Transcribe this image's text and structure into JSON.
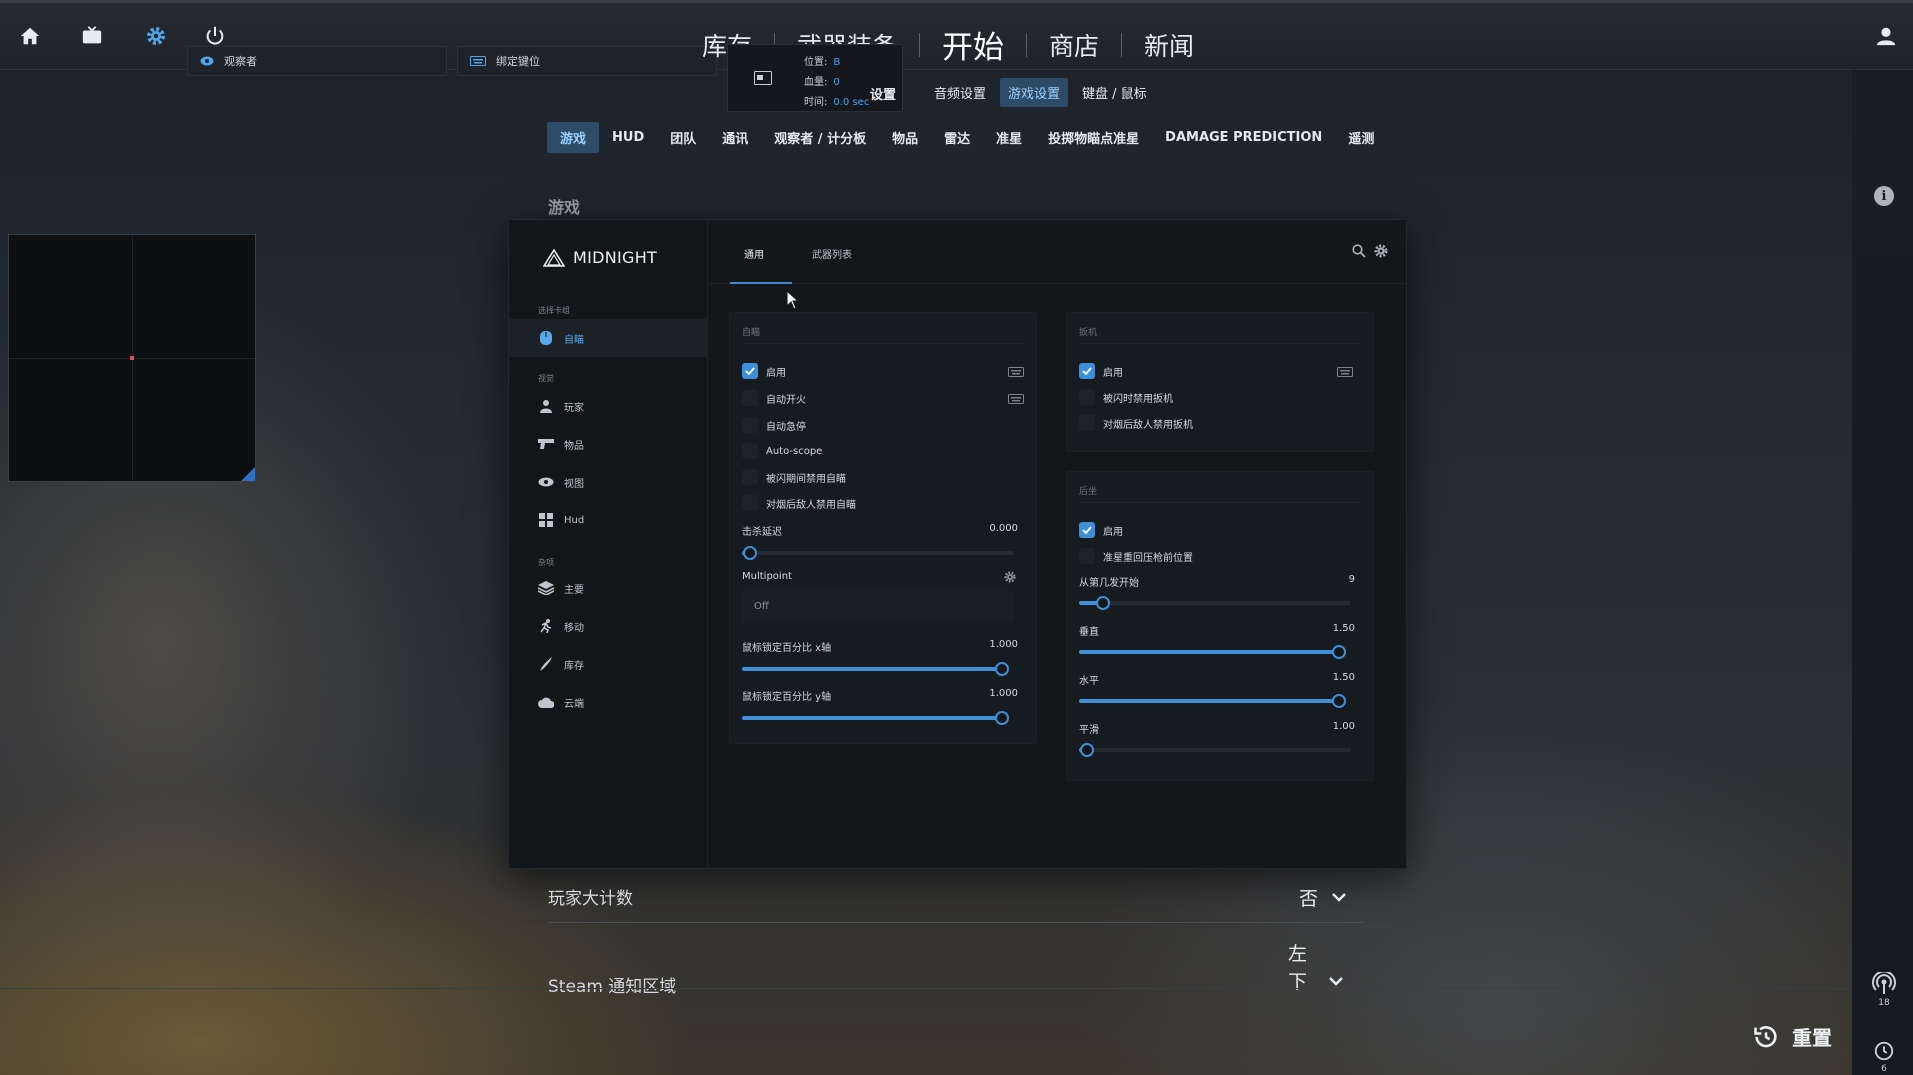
{
  "topnav": {
    "items": [
      {
        "label": "库存",
        "active": false
      },
      {
        "label": "武器装备",
        "active": false
      },
      {
        "label": "开始",
        "active": true
      },
      {
        "label": "商店",
        "active": false
      },
      {
        "label": "新闻",
        "active": false
      }
    ],
    "chips": [
      {
        "label": "观察者",
        "icon": "eye-icon"
      },
      {
        "label": "绑定键位",
        "icon": "keyboard-icon"
      }
    ]
  },
  "overlay": {
    "rows": [
      {
        "label": "位置:",
        "value": "B"
      },
      {
        "label": "血量:",
        "value": "0"
      },
      {
        "label": "时间:",
        "value": "0.0 sec"
      }
    ],
    "partial_tab": "设置"
  },
  "settings_tabs": [
    {
      "label": "音频设置",
      "active": false
    },
    {
      "label": "游戏设置",
      "active": true
    },
    {
      "label": "键盘 / 鼠标",
      "active": false
    }
  ],
  "sub_tabs": [
    {
      "label": "游戏",
      "active": true
    },
    {
      "label": "HUD",
      "active": false
    },
    {
      "label": "团队",
      "active": false
    },
    {
      "label": "通讯",
      "active": false
    },
    {
      "label": "观察者 / 计分板",
      "active": false
    },
    {
      "label": "物品",
      "active": false
    },
    {
      "label": "雷达",
      "active": false
    },
    {
      "label": "准星",
      "active": false
    },
    {
      "label": "投掷物瞄点准星",
      "active": false
    },
    {
      "label": "DAMAGE PREDICTION",
      "active": false
    },
    {
      "label": "遥测",
      "active": false
    }
  ],
  "section_title": "游戏",
  "panel": {
    "brand": "MIDNIGHT",
    "groups": [
      {
        "label": "选择卡组"
      },
      {
        "label": "视觉"
      },
      {
        "label": "杂项"
      }
    ],
    "side_items": [
      {
        "label": "自瞄",
        "icon": "aim-icon",
        "active": true
      },
      {
        "label": "玩家",
        "icon": "user-icon",
        "active": false
      },
      {
        "label": "物品",
        "icon": "gun-icon",
        "active": false
      },
      {
        "label": "视图",
        "icon": "eye-icon",
        "active": false
      },
      {
        "label": "Hud",
        "icon": "grid-icon",
        "active": false
      },
      {
        "label": "主要",
        "icon": "layers-icon",
        "active": false
      },
      {
        "label": "移动",
        "icon": "run-icon",
        "active": false
      },
      {
        "label": "库存",
        "icon": "knife-icon",
        "active": false
      },
      {
        "label": "云端",
        "icon": "cloud-icon",
        "active": false
      }
    ],
    "tabs": [
      {
        "label": "通用",
        "active": true
      },
      {
        "label": "武器列表",
        "active": false
      }
    ],
    "aimbot": {
      "title": "自瞄",
      "options": [
        {
          "label": "启用",
          "checked": true
        },
        {
          "label": "自动开火",
          "checked": false
        },
        {
          "label": "自动急停",
          "checked": false
        },
        {
          "label": "Auto-scope",
          "checked": false
        },
        {
          "label": "被闪期间禁用自瞄",
          "checked": false
        },
        {
          "label": "对烟后敌人禁用自瞄",
          "checked": false
        }
      ],
      "kill_delay": {
        "label": "击杀延迟",
        "value": "0.000",
        "fraction": 0.0
      },
      "multipoint": {
        "label": "Multipoint",
        "selected": "Off"
      },
      "lock_x": {
        "label": "鼠标锁定百分比 x轴",
        "value": "1.000",
        "fraction": 1.0
      },
      "lock_y": {
        "label": "鼠标锁定百分比 y轴",
        "value": "1.000",
        "fraction": 1.0
      }
    },
    "trigger": {
      "title": "扳机",
      "options": [
        {
          "label": "启用",
          "checked": true
        },
        {
          "label": "被闪时禁用扳机",
          "checked": false
        },
        {
          "label": "对烟后敌人禁用扳机",
          "checked": false
        }
      ]
    },
    "recoil": {
      "title": "后坐",
      "options": [
        {
          "label": "启用",
          "checked": true
        },
        {
          "label": "准星重回压枪前位置",
          "checked": false
        }
      ],
      "start_shot": {
        "label": "从第几发开始",
        "value": "9",
        "fraction": 0.09
      },
      "vertical": {
        "label": "垂直",
        "value": "1.50",
        "fraction": 1.0
      },
      "horizontal": {
        "label": "水平",
        "value": "1.50",
        "fraction": 1.0
      },
      "smooth": {
        "label": "平滑",
        "value": "1.00",
        "fraction": 0.0
      }
    }
  },
  "rows": {
    "player_scoreboard": {
      "label": "玩家大计数",
      "value": "否"
    },
    "steam_notify": {
      "label": "Steam 通知区域",
      "value_line1": "左",
      "value_line2": "下"
    }
  },
  "rail": {
    "badge1": "18",
    "badge2": "6"
  },
  "reset_label": "重置",
  "colors": {
    "accent": "#3e8fd8",
    "active_tab_bg": "#2e4c68"
  }
}
